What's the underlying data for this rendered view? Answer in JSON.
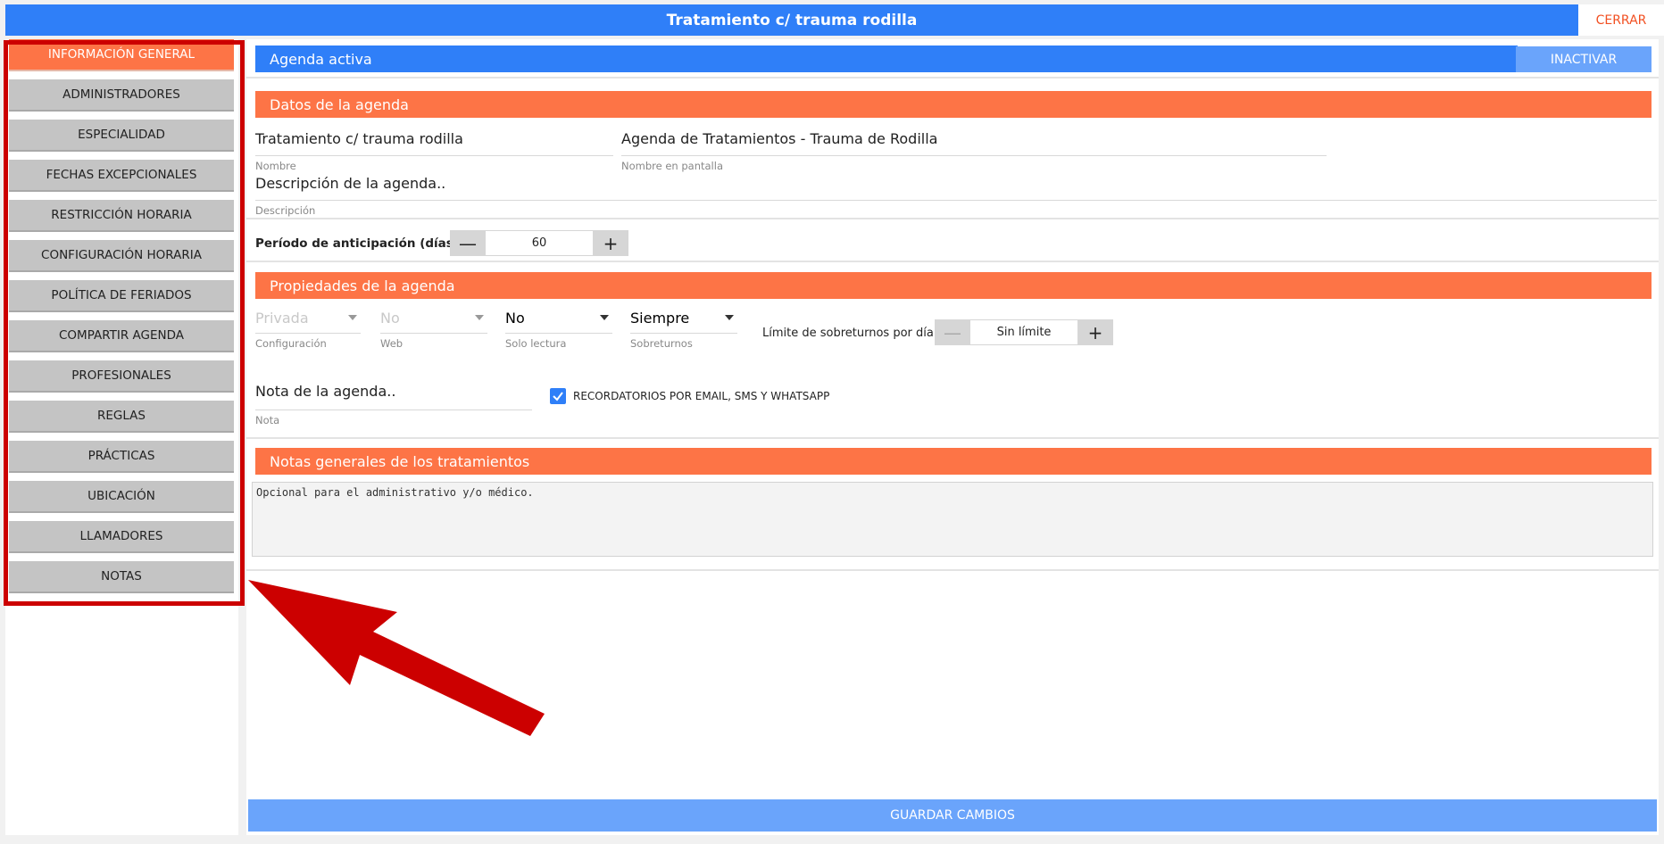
{
  "header": {
    "title": "Tratamiento c/ trauma rodilla",
    "close_label": "CERRAR"
  },
  "sidebar": {
    "items": [
      {
        "label": "INFORMACIÓN GENERAL",
        "active": true
      },
      {
        "label": "ADMINISTRADORES"
      },
      {
        "label": "ESPECIALIDAD"
      },
      {
        "label": "FECHAS EXCEPCIONALES"
      },
      {
        "label": "RESTRICCIÓN HORARIA"
      },
      {
        "label": "CONFIGURACIÓN HORARIA"
      },
      {
        "label": "POLÍTICA DE FERIADOS"
      },
      {
        "label": "COMPARTIR AGENDA"
      },
      {
        "label": "PROFESIONALES"
      },
      {
        "label": "REGLAS"
      },
      {
        "label": "PRÁCTICAS"
      },
      {
        "label": "UBICACIÓN"
      },
      {
        "label": "LLAMADORES"
      },
      {
        "label": "NOTAS"
      }
    ]
  },
  "main": {
    "status_title": "Agenda activa",
    "inactivar_label": "INACTIVAR",
    "datos": {
      "section_title": "Datos de la agenda",
      "nombre_value": "Tratamiento c/ trauma rodilla",
      "nombre_label": "Nombre",
      "pantalla_value": "Agenda de Tratamientos - Trauma de Rodilla",
      "pantalla_label": "Nombre en pantalla",
      "descripcion_placeholder": "Descripción de la agenda..",
      "descripcion_label": "Descripción"
    },
    "anticipacion": {
      "label": "Período de anticipación (días):",
      "value": "60"
    },
    "propiedades": {
      "section_title": "Propiedades de la agenda",
      "configuracion": {
        "value": "Privada",
        "label": "Configuración"
      },
      "web": {
        "value": "No",
        "label": "Web"
      },
      "solo_lectura": {
        "value": "No",
        "label": "Solo lectura"
      },
      "sobreturnos": {
        "value": "Siempre",
        "label": "Sobreturnos"
      },
      "limite_label": "Límite de sobreturnos por día:",
      "limite_value": "Sin límite",
      "nota_placeholder": "Nota de la agenda..",
      "nota_label": "Nota",
      "recordatorios_label": "RECORDATORIOS POR EMAIL, SMS Y WHATSAPP"
    },
    "notas": {
      "section_title": "Notas generales de los tratamientos",
      "placeholder": "Opcional para el administrativo y/o médico."
    },
    "save_label": "GUARDAR CAMBIOS"
  },
  "colors": {
    "blue": "#2f7ff8",
    "orange": "#fd7446",
    "highlight_red": "#cc0000"
  },
  "icons": [
    "minus-icon",
    "plus-icon",
    "chevron-down-icon",
    "checkmark-icon",
    "red-arrow-annotation"
  ]
}
